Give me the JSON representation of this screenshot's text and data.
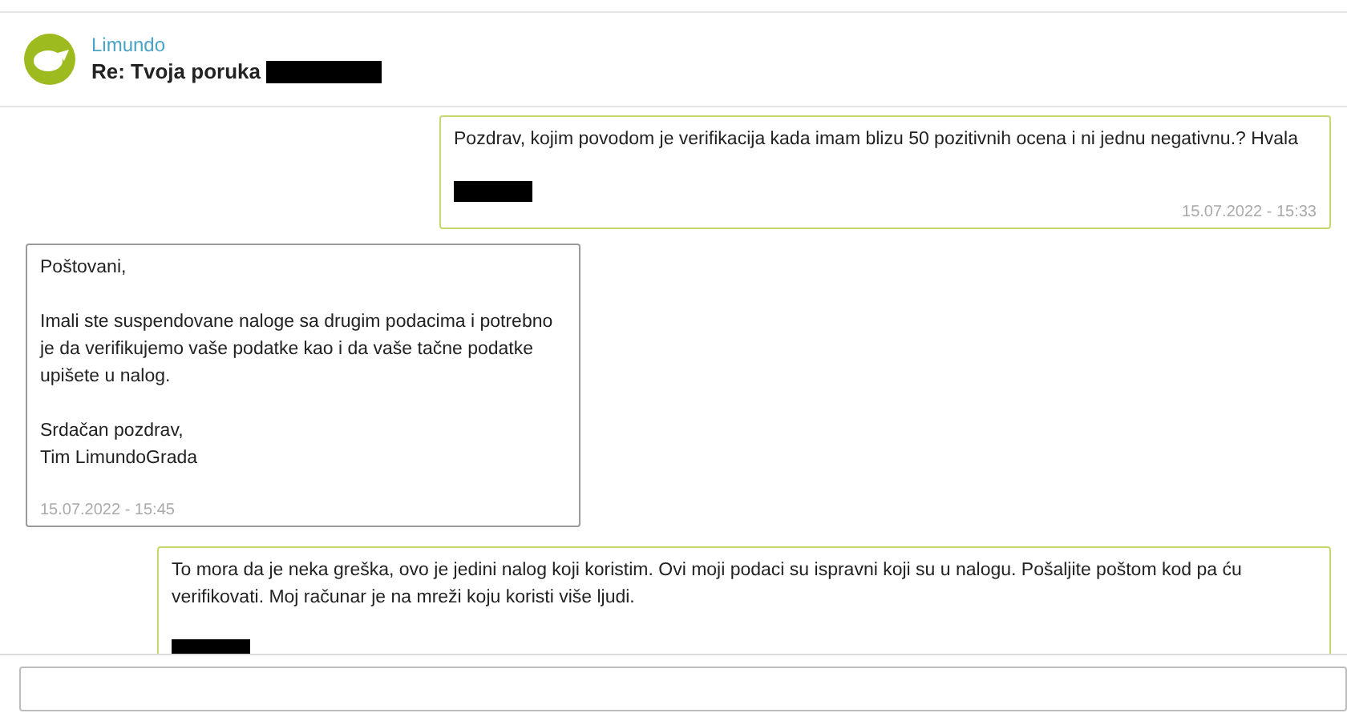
{
  "header": {
    "sender": "Limundo",
    "subject": "Re: Tvoja poruka",
    "subject_redacted": true
  },
  "messages": [
    {
      "kind": "sent",
      "paragraphs": [
        [
          "Pozdrav, kojim povodom je verifikacija kada imam blizu 50 pozitivnih ocena i ni jednu negativnu.? Hvala"
        ]
      ],
      "redacted": true,
      "time": "15.07.2022 - 15:33"
    },
    {
      "kind": "received",
      "paragraphs": [
        [
          "Poštovani,"
        ],
        [
          "Imali ste suspendovane naloge sa drugim podacima i potrebno je da verifikujemo vaše podatke kao i da vaše tačne podatke upišete u nalog."
        ],
        [
          "Srdačan pozdrav,",
          "Tim LimundoGrada"
        ]
      ],
      "redacted": false,
      "time": "15.07.2022 - 15:45"
    },
    {
      "kind": "sent",
      "paragraphs": [
        [
          "To mora da je neka greška, ovo je jedini nalog koji koristim. Ovi moji podaci su ispravni koji su u nalogu. Pošaljite poštom kod pa ću verifikovati. Moj računar je na mreži koju koristi više ljudi."
        ]
      ],
      "redacted": true
    }
  ]
}
